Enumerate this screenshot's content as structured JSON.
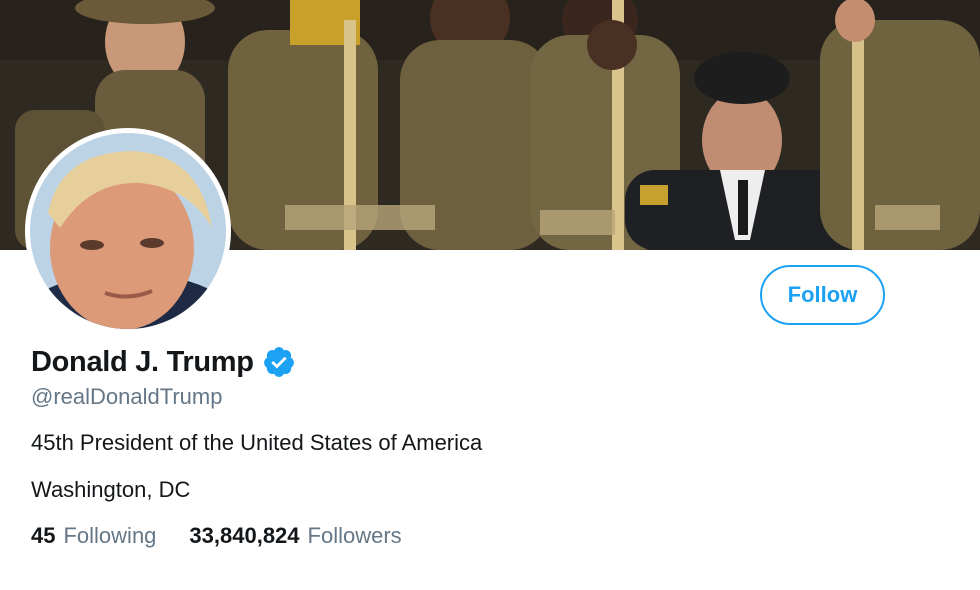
{
  "profile": {
    "name": "Donald J. Trump",
    "handle": "@realDonaldTrump",
    "bio": "45th President of the United States of America",
    "location": "Washington, DC",
    "verified": true,
    "verified_color": "#1da1f2"
  },
  "actions": {
    "follow_label": "Follow"
  },
  "stats": {
    "following_count": "45",
    "following_label": "Following",
    "followers_count": "33,840,824",
    "followers_label": "Followers"
  },
  "colors": {
    "accent": "#1da1f2",
    "text_primary": "#14171a",
    "text_secondary": "#657786"
  }
}
